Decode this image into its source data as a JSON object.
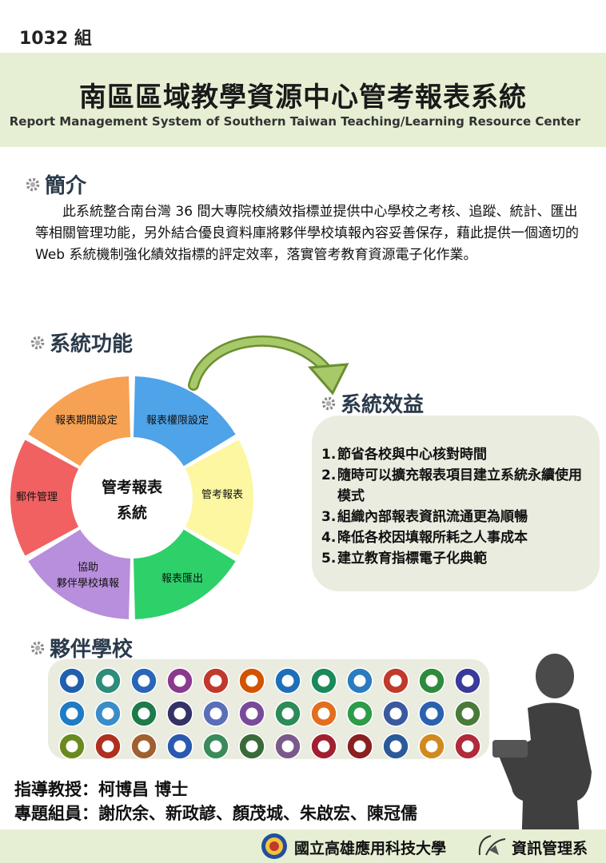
{
  "header": {
    "group": "1032 組",
    "title": "南區區域教學資源中心管考報表系統",
    "subtitle": "Report Management System of Southern Taiwan Teaching/Learning Resource Center"
  },
  "intro": {
    "heading": "簡介",
    "text": "此系統整合南台灣 36 間大專院校績效指標並提供中心學校之考核、追蹤、統計、匯出等相關管理功能，另外結合優良資料庫將夥伴學校填報內容妥善保存，藉此提供一個適切的 Web 系統機制強化績效指標的評定效率，落實管考教育資源電子化作業。"
  },
  "functions": {
    "heading": "系統功能",
    "center_line1": "管考報表",
    "center_line2": "系統",
    "segments": [
      {
        "label": "報表權限設定",
        "color": "#4fa3e8"
      },
      {
        "label": "管考報表",
        "color": "#fcf7a0"
      },
      {
        "label": "報表匯出",
        "color": "#2ed06a"
      },
      {
        "label_line1": "協助",
        "label_line2": "夥伴學校填報",
        "color": "#b88fdc"
      },
      {
        "label": "郵件管理",
        "color": "#f16161"
      },
      {
        "label": "報表期間設定",
        "color": "#f6a153"
      }
    ]
  },
  "benefits": {
    "heading": "系統效益",
    "items": [
      {
        "num": "1.",
        "text": "節省各校與中心核對時間"
      },
      {
        "num": "2.",
        "text": "隨時可以擴充報表項目建立系統永續使用模式"
      },
      {
        "num": "3.",
        "text": "組織內部報表資訊流通更為順暢"
      },
      {
        "num": "4.",
        "text": "降低各校因填報所耗之人事成本"
      },
      {
        "num": "5.",
        "text": "建立教育指標電子化典範"
      }
    ]
  },
  "partners": {
    "heading": "夥伴學校",
    "logo_colors": [
      "#1f5fae",
      "#2d8c7a",
      "#2a66b8",
      "#8a3a8e",
      "#c0392b",
      "#d35400",
      "#1e6fb8",
      "#1b8a5a",
      "#2b7bc0",
      "#c0392b",
      "#2e8b3d",
      "#3a3a9a",
      "#1f7bc4",
      "#3a8dc8",
      "#1e7a4a",
      "#333366",
      "#5a6fb8",
      "#7a4a9a",
      "#2e8b57",
      "#e07020",
      "#2e9b48",
      "#3a5aa0",
      "#2a62b0",
      "#4a7a3a",
      "#6a8a20",
      "#b03020",
      "#a06030",
      "#2a5ab0",
      "#3a8a5a",
      "#3a6a3a",
      "#7a5a8a",
      "#a02030",
      "#8a2020",
      "#2a5a9a",
      "#d08a20",
      "#b02a3a"
    ]
  },
  "credits": {
    "advisor": "指導教授：柯博昌 博士",
    "members": "專題組員：謝欣余、新政諺、顏茂城、朱啟宏、陳冠儒"
  },
  "footer": {
    "university": "國立高雄應用科技大學",
    "department": "資訊管理系"
  }
}
